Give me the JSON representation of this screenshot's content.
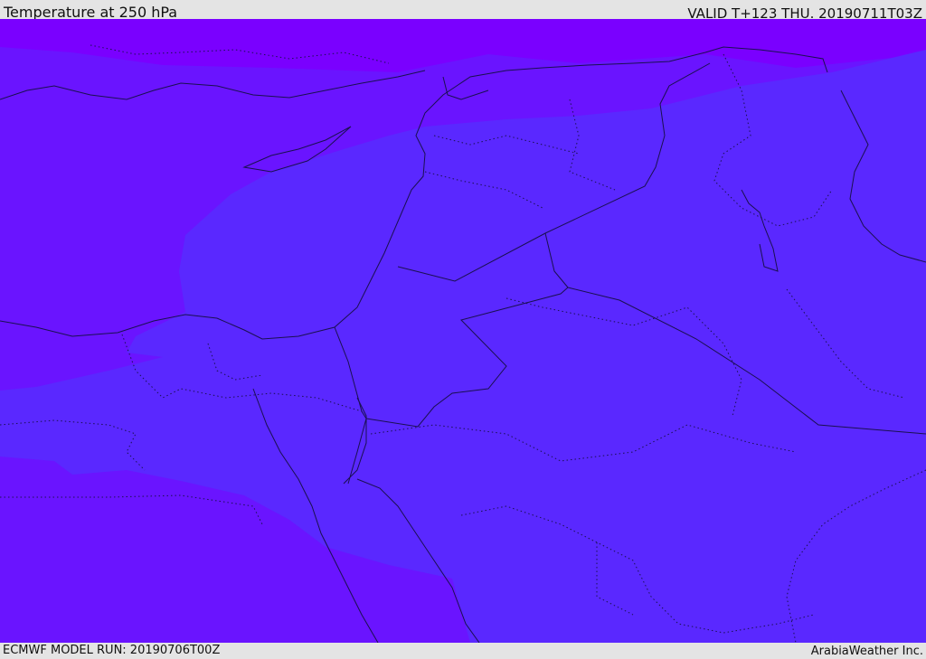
{
  "header": {
    "title": "Temperature at 250 hPa",
    "valid": "VALID T+123 THU. 20190711T03Z"
  },
  "footer": {
    "model_run": "ECMWF MODEL RUN: 20190706T00Z",
    "credit": "ArabiaWeather Inc."
  },
  "map": {
    "colors": {
      "cold_band": "#7a00ff",
      "mid_band": "#6a14ff",
      "warm_band": "#5a28ff",
      "coastline": "#1a1050",
      "border": "#1a1050"
    }
  }
}
